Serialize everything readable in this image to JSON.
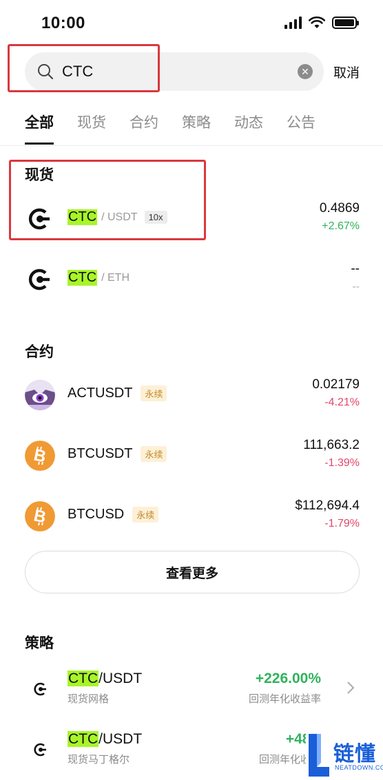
{
  "status_bar": {
    "time": "10:00"
  },
  "search": {
    "value": "CTC",
    "cancel_label": "取消"
  },
  "tabs": [
    {
      "label": "全部",
      "active": true
    },
    {
      "label": "现货",
      "active": false
    },
    {
      "label": "合约",
      "active": false
    },
    {
      "label": "策略",
      "active": false
    },
    {
      "label": "动态",
      "active": false
    },
    {
      "label": "公告",
      "active": false
    }
  ],
  "spot": {
    "title": "现货",
    "items": [
      {
        "base": "CTC",
        "quote": "/ USDT",
        "leverage": "10x",
        "price": "0.4869",
        "change": "+2.67%",
        "icon": "ctc-logo-icon"
      },
      {
        "base": "CTC",
        "quote": "/ ETH",
        "price": "--",
        "change": "--",
        "icon": "ctc-logo-icon"
      }
    ]
  },
  "futures": {
    "title": "合约",
    "items": [
      {
        "name": "ACTUSDT",
        "badge": "永续",
        "price": "0.02179",
        "change": "-4.21%",
        "icon": "act-avatar-icon"
      },
      {
        "name": "BTCUSDT",
        "badge": "永续",
        "price": "111,663.2",
        "change": "-1.39%",
        "icon": "bitcoin-icon"
      },
      {
        "name": "BTCUSD",
        "badge": "永续",
        "price": "$112,694.4",
        "change": "-1.79%",
        "icon": "bitcoin-icon"
      }
    ],
    "more_label": "查看更多"
  },
  "strategy": {
    "title": "策略",
    "items": [
      {
        "base": "CTC",
        "pair_rest": "/USDT",
        "type": "现货网格",
        "return": "+226.00%",
        "return_label": "回测年化收益率"
      },
      {
        "base": "CTC",
        "pair_rest": "/USDT",
        "type": "现货马丁格尔",
        "return": "+48.0",
        "return_label": "回测年化收益"
      }
    ]
  },
  "watermark": {
    "text": "链懂",
    "sub": "NEATDOWN.COM"
  },
  "colors": {
    "up": "#2fb35b",
    "down": "#e0466a",
    "highlight": "#a8f529",
    "annotation": "#d9383e"
  }
}
